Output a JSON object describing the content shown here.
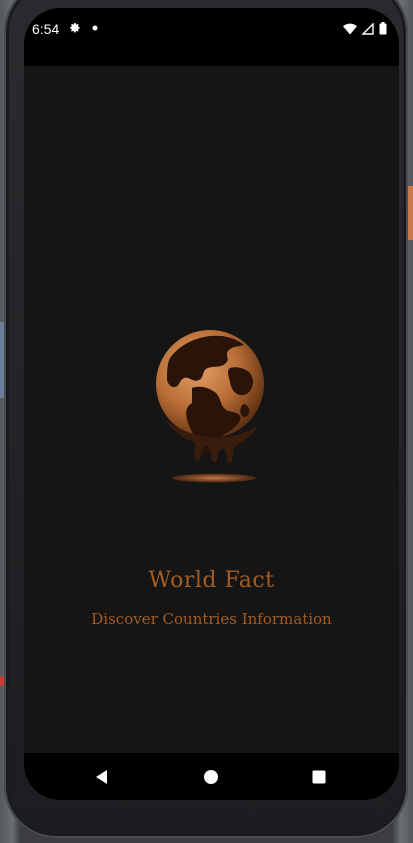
{
  "status_bar": {
    "time": "6:54",
    "left_icons": [
      "gear-icon",
      "notification-dot-icon"
    ],
    "right_icons": [
      "wifi-icon",
      "signal-icon",
      "battery-icon"
    ]
  },
  "app": {
    "logo_icon": "melting-globe-icon",
    "title": "World Fact",
    "subtitle": "Discover Countries Information",
    "accent_color": "#a45c22",
    "background_color": "#151515"
  },
  "nav_bar": {
    "buttons": [
      "back-icon",
      "home-icon",
      "recents-icon"
    ]
  }
}
